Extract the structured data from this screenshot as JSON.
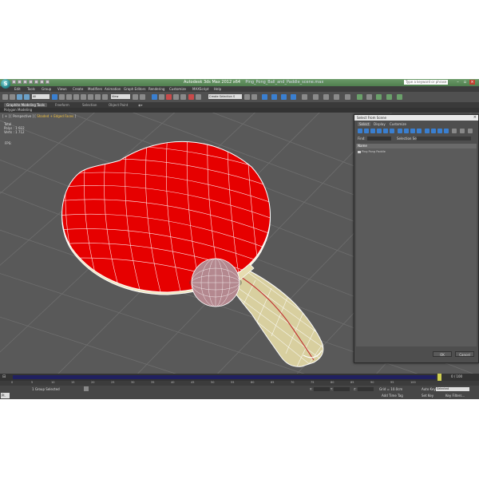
{
  "window": {
    "title": "Autodesk 3ds Max 2012 x64",
    "filename": "Ping_Pong_Ball_and_Paddle_scene.max",
    "search_placeholder": "Type a keyword or phrase",
    "app_logo": "S"
  },
  "menu": [
    "Edit",
    "Tools",
    "Group",
    "Views",
    "Create",
    "Modifiers",
    "Animation",
    "Graph Editors",
    "Rendering",
    "Customize",
    "MAXScript",
    "Help"
  ],
  "toolbar": {
    "filter_value": "All",
    "view_value": "View",
    "selection_set": "Create Selection S"
  },
  "ribbon": {
    "tabs": [
      "Graphite Modeling Tools",
      "Freeform",
      "Selection",
      "Object Paint"
    ],
    "panel": "Polygon Modeling"
  },
  "viewport": {
    "label_prefix": "[ + ] [ Perspective ] [ ",
    "shading_label": "Shaded + Edged Faces",
    "label_suffix": " ]",
    "stats": [
      {
        "label": "Total",
        "value": ""
      },
      {
        "label": "Polys :",
        "value": "1 022"
      },
      {
        "label": "Verts :",
        "value": "1 712"
      }
    ],
    "fps_label": "FPS:"
  },
  "dialog": {
    "title": "Select From Scene",
    "tabs": [
      "Select",
      "Display",
      "Customize"
    ],
    "find_label": "Find:",
    "selection_set_label": "Selection Set:",
    "column_name": "Name",
    "items": [
      "Ping Pong Paddle"
    ],
    "ok_label": "OK",
    "cancel_label": "Cancel"
  },
  "timeline": {
    "frame_display": "0 / 100",
    "ruler_ticks": [
      "0",
      "5",
      "10",
      "15",
      "20",
      "25",
      "30",
      "35",
      "40",
      "45",
      "50",
      "55",
      "60",
      "65",
      "70",
      "75",
      "80",
      "85",
      "90",
      "95",
      "100"
    ]
  },
  "status": {
    "selection": "1 Group Selected",
    "taskbar": "Pl.",
    "x_label": "X:",
    "y_label": "Y:",
    "z_label": "Z:",
    "grid_text": "Grid = 10.0cm",
    "auto_key": "Auto Key",
    "selected_value": "Selected",
    "set_key": "Set Key",
    "key_filters": "Key Filters...",
    "add_time_tag": "Add Time Tag"
  },
  "colors": {
    "rubber_red": "#e60000",
    "handle_wood": "#d8cf9f",
    "ball": "#b4888f",
    "viewport_bg": "#595959",
    "grid_line": "#6e6e6e"
  }
}
